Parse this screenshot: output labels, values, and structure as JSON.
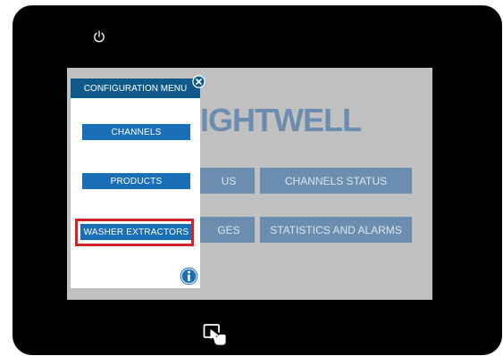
{
  "screen": {
    "brand_text": "IGHTWELL",
    "tiles": [
      {
        "label": "US"
      },
      {
        "label": "CHANNELS STATUS"
      },
      {
        "label": "GES"
      },
      {
        "label": "STATISTICS AND ALARMS"
      }
    ]
  },
  "config_menu": {
    "title": "CONFIGURATION MENU",
    "items": [
      {
        "label": "CHANNELS"
      },
      {
        "label": "PRODUCTS"
      },
      {
        "label": "WASHER EXTRACTORS",
        "highlighted": true
      }
    ]
  },
  "icons": {
    "power": "power-icon",
    "close": "close-icon",
    "info": "info-icon",
    "touch": "touch-screen-icon"
  },
  "colors": {
    "device_bezel": "#000000",
    "screen_background": "#c0c0c0",
    "menu_header": "#0f5a8a",
    "menu_button": "#1a6fb6",
    "tile": "#6b8eb0",
    "highlight": "#d1232a"
  }
}
